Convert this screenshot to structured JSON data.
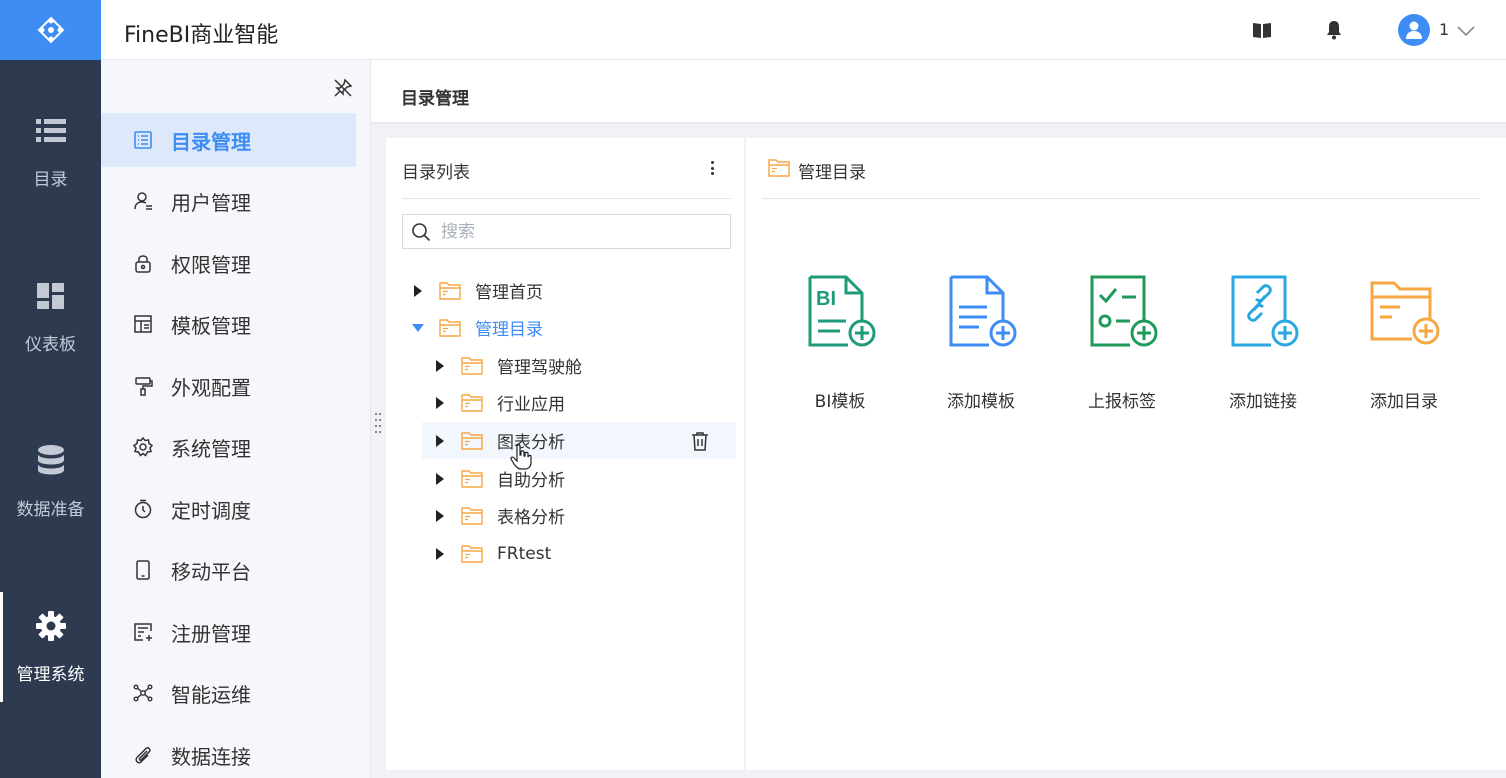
{
  "header": {
    "app_title": "FineBI商业智能",
    "user_name": "1",
    "icons": [
      "logo-icon",
      "book-icon",
      "bell-icon",
      "user-avatar-icon",
      "chevron-down-icon"
    ],
    "brand_color": "#3d8df5"
  },
  "rail": {
    "items": [
      {
        "label": "目录",
        "icon": "list-icon"
      },
      {
        "label": "仪表板",
        "icon": "dashboard-icon"
      },
      {
        "label": "数据准备",
        "icon": "database-icon"
      },
      {
        "label": "管理系统",
        "icon": "gear-icon",
        "active": true
      }
    ]
  },
  "menu": {
    "items": [
      {
        "label": "目录管理",
        "icon": "catalog-icon",
        "active": true
      },
      {
        "label": "用户管理",
        "icon": "user-icon"
      },
      {
        "label": "权限管理",
        "icon": "lock-icon"
      },
      {
        "label": "模板管理",
        "icon": "template-icon"
      },
      {
        "label": "外观配置",
        "icon": "brush-icon"
      },
      {
        "label": "系统管理",
        "icon": "settings-icon"
      },
      {
        "label": "定时调度",
        "icon": "timer-icon"
      },
      {
        "label": "移动平台",
        "icon": "tablet-icon"
      },
      {
        "label": "注册管理",
        "icon": "register-icon"
      },
      {
        "label": "智能运维",
        "icon": "network-icon"
      },
      {
        "label": "数据连接",
        "icon": "paperclip-icon"
      }
    ]
  },
  "page": {
    "title": "目录管理"
  },
  "left_panel": {
    "title": "目录列表",
    "search_placeholder": "搜索",
    "tree": [
      {
        "label": "管理首页",
        "level": 0,
        "expanded": false
      },
      {
        "label": "管理目录",
        "level": 0,
        "expanded": true,
        "selected": true
      },
      {
        "label": "管理驾驶舱",
        "level": 1,
        "expanded": false
      },
      {
        "label": "行业应用",
        "level": 1,
        "expanded": false
      },
      {
        "label": "图表分析",
        "level": 1,
        "expanded": false,
        "hover": true
      },
      {
        "label": "自助分析",
        "level": 1,
        "expanded": false
      },
      {
        "label": "表格分析",
        "level": 1,
        "expanded": false
      },
      {
        "label": "FRtest",
        "level": 1,
        "expanded": false
      }
    ]
  },
  "right_panel": {
    "title": "管理目录",
    "cards": [
      {
        "label": "BI模板",
        "icon": "bi-template-add-icon",
        "color": "#1f9a7a"
      },
      {
        "label": "添加模板",
        "icon": "template-add-icon",
        "color": "#3d8df5"
      },
      {
        "label": "上报标签",
        "icon": "report-tag-add-icon",
        "color": "#1f9a5a"
      },
      {
        "label": "添加链接",
        "icon": "link-add-icon",
        "color": "#2aa7e0"
      },
      {
        "label": "添加目录",
        "icon": "folder-add-icon",
        "color": "#f5a742"
      }
    ]
  }
}
